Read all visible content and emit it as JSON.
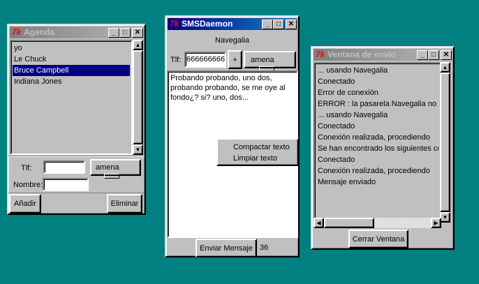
{
  "agenda": {
    "title": "Agenda",
    "contacts": [
      "yo",
      "Le Chuck",
      "Bruce Campbell",
      "Indiana Jones"
    ],
    "selected_index": 2,
    "tlf_label": "Tlf:",
    "tlf_value": "",
    "carrier": "amena",
    "nombre_label": "Nombre:",
    "nombre_value": "",
    "add_label": "Añadir",
    "delete_label": "Eliminar"
  },
  "sms": {
    "title": "SMSDaemon",
    "gateway": "Navegalia",
    "tlf_label": "Tlf:",
    "tlf_value": "666666666",
    "plus_label": "+",
    "carrier": "amena",
    "message": "Probando probando, uno dos, probando probando, se me oye al fondo¿? si? uno, dos...",
    "context_menu": [
      "Compactar texto",
      "Limpiar texto"
    ],
    "send_label": "Enviar Mensaje",
    "char_count": "36"
  },
  "envio": {
    "title": "Ventana de envio",
    "log": [
      "... usando Navegalia",
      "Conectado",
      "Error de conexión",
      "ERROR : la pasarela Navegalia no pu",
      "... usando Navegalia",
      "Conectado",
      "Conexión realizada, procediendo",
      "Se han encontrado los siguientes cod",
      "Conectado",
      "Conexión realizada, procediendo",
      "Mensaje enviado"
    ],
    "close_label": "Cerrar Ventana"
  },
  "colors": {
    "desktop": "#008080",
    "selection": "#000080",
    "active_title": "#000080"
  }
}
